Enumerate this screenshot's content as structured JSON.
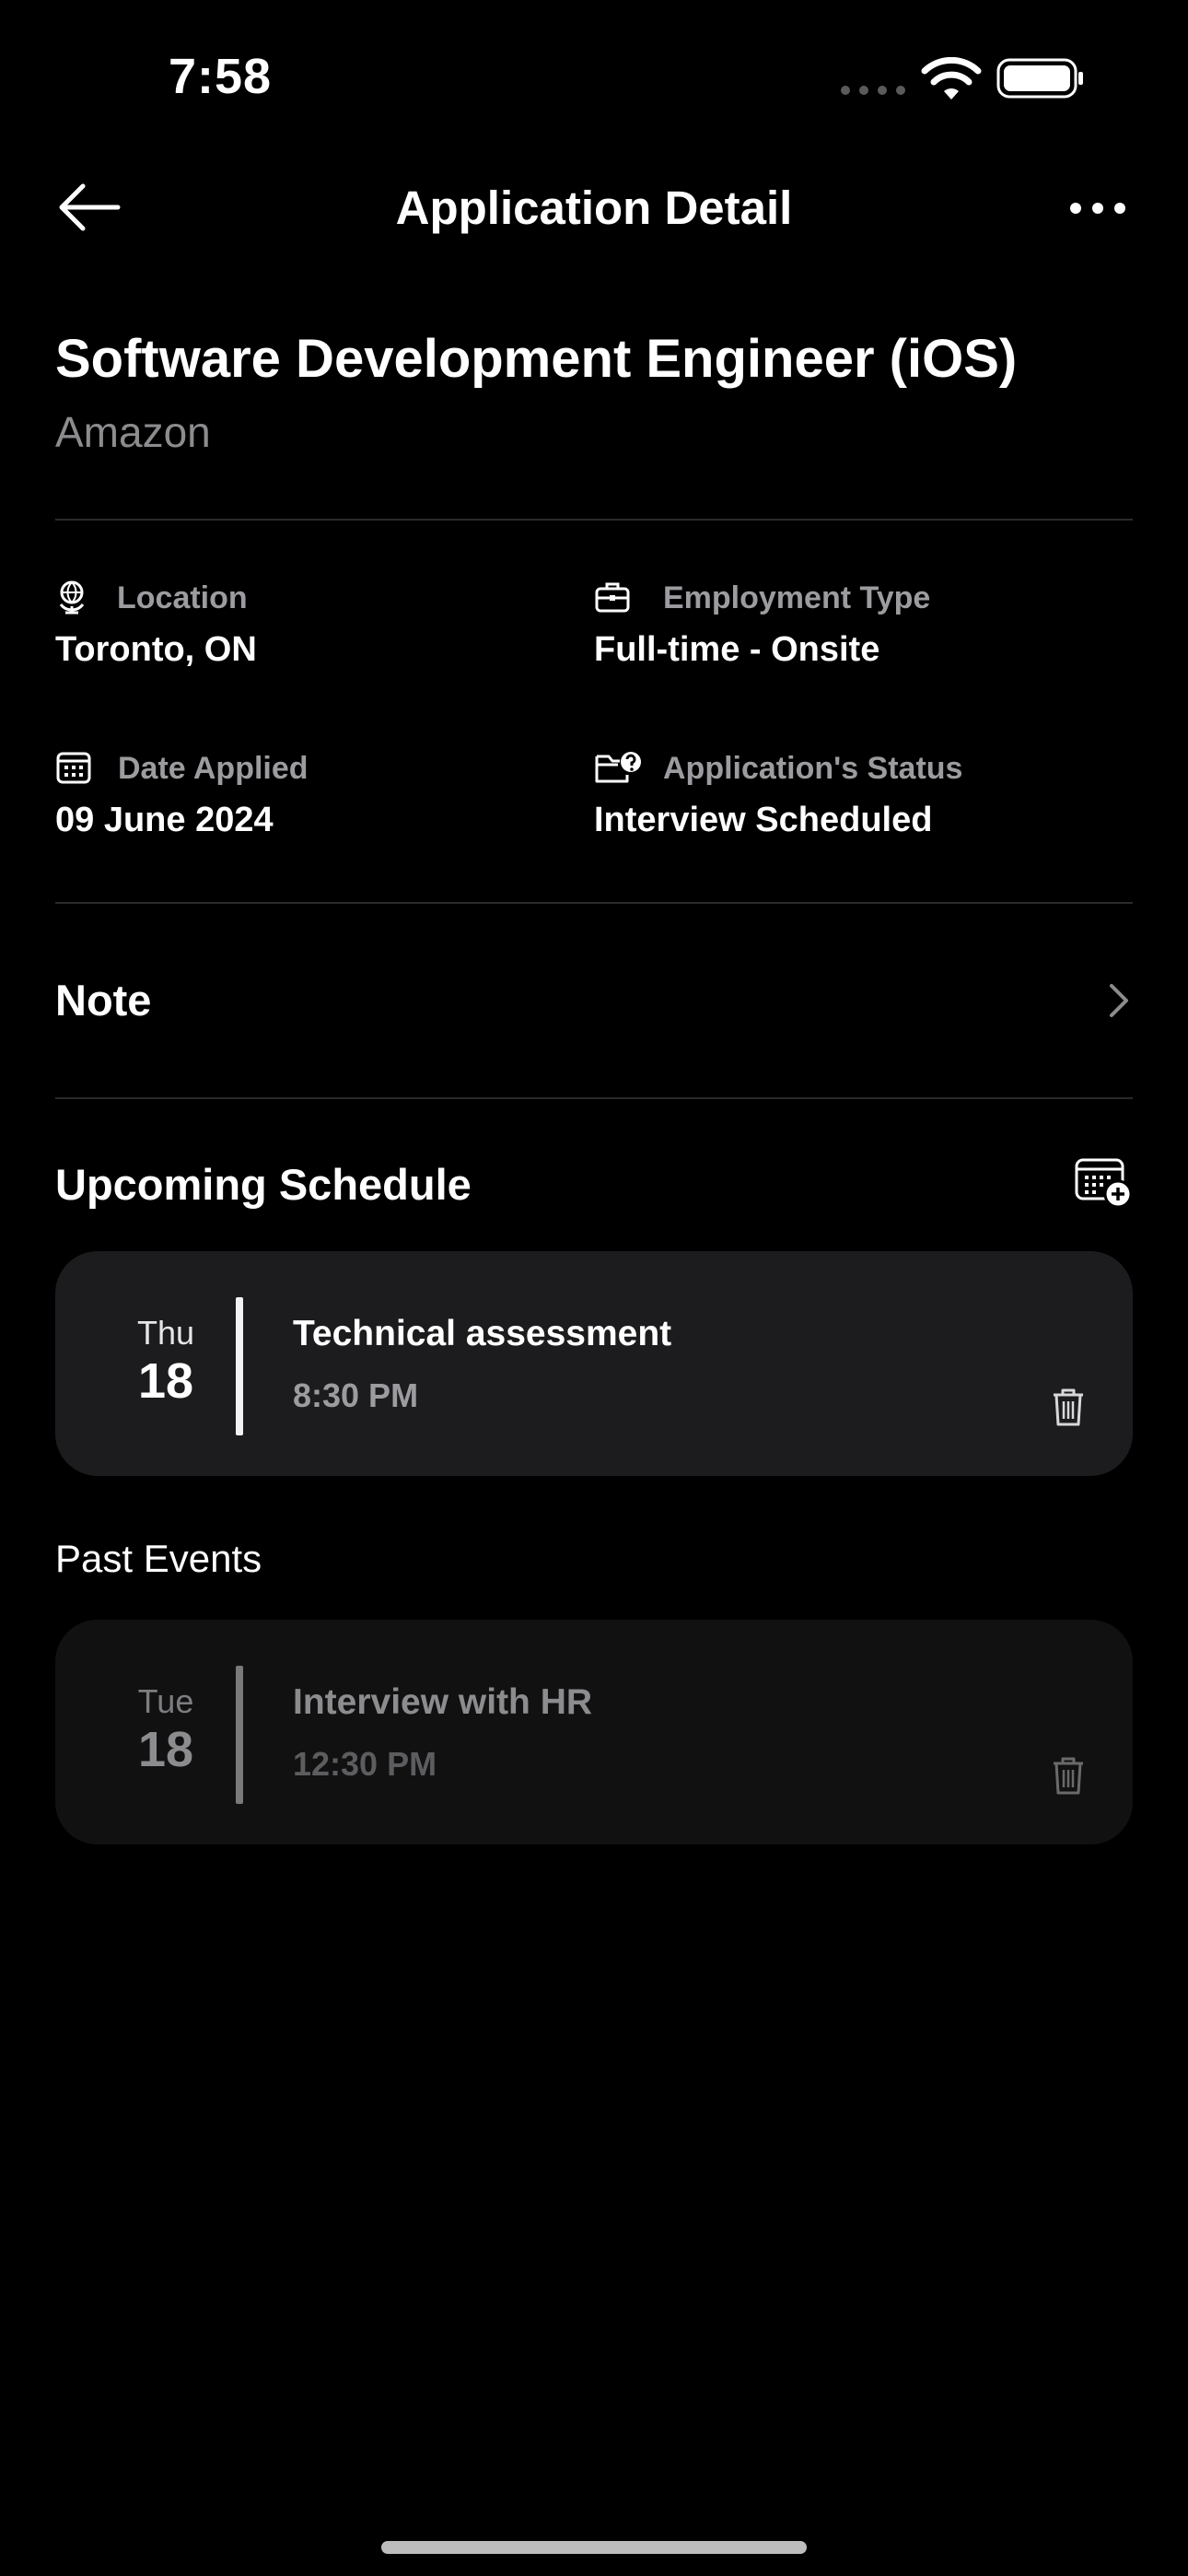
{
  "status_bar": {
    "time": "7:58"
  },
  "nav": {
    "title": "Application Detail"
  },
  "job": {
    "title": "Software Development Engineer (iOS)",
    "company": "Amazon"
  },
  "info": {
    "location": {
      "label": "Location",
      "value": "Toronto, ON",
      "icon": "globe-icon"
    },
    "employment_type": {
      "label": "Employment Type",
      "value": "Full-time - Onsite",
      "icon": "briefcase-icon"
    },
    "date_applied": {
      "label": "Date Applied",
      "value": "09 June 2024",
      "icon": "calendar-icon"
    },
    "status": {
      "label": "Application's Status",
      "value": "Interview Scheduled",
      "icon": "folder-question-icon"
    }
  },
  "note": {
    "label": "Note"
  },
  "upcoming": {
    "title": "Upcoming Schedule",
    "events": [
      {
        "day": "Thu",
        "date": "18",
        "name": "Technical assessment",
        "time": "8:30 PM"
      }
    ]
  },
  "past": {
    "title": "Past Events",
    "events": [
      {
        "day": "Tue",
        "date": "18",
        "name": "Interview with HR",
        "time": "12:30 PM"
      }
    ]
  },
  "colors": {
    "background": "#000000",
    "card_active": "#1c1c1e",
    "card_past": "#111112",
    "secondary_text": "#8c8c8f"
  }
}
